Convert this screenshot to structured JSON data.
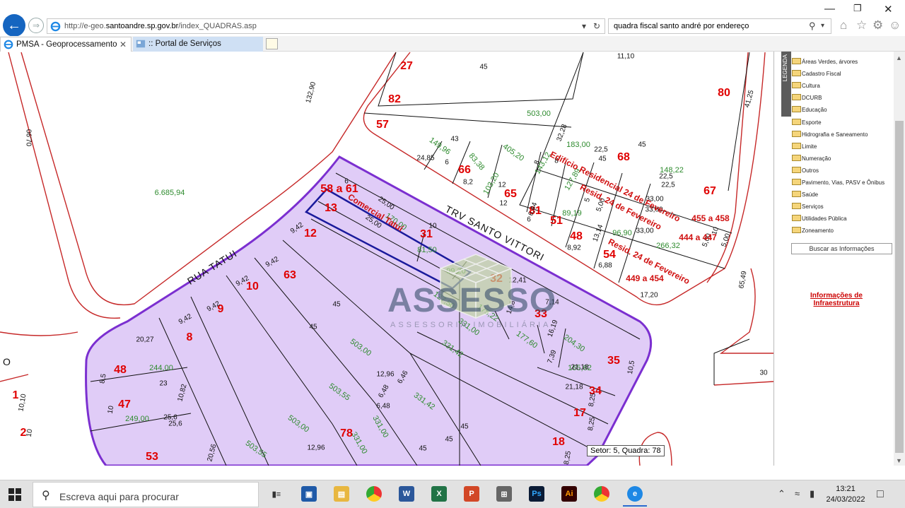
{
  "browser": {
    "url_prefix": "http://e-geo.",
    "url_domain": "santoandre.sp.gov.br",
    "url_path": "/index_QUADRAS.asp",
    "search_query": "quadra fiscal santo andré por endereço",
    "tabs": [
      {
        "label": "PMSA - Geoprocessamento"
      },
      {
        "label": ":: Portal de Serviços"
      }
    ]
  },
  "map": {
    "street_labels": [
      "RUA TATUI",
      "TRV SANTO VITTORI"
    ],
    "lot_numbers": [
      "27",
      "82",
      "57",
      "80",
      "66",
      "65",
      "81",
      "68",
      "67",
      "58 a 61",
      "13",
      "31",
      "12",
      "51",
      "48",
      "54",
      "63",
      "32",
      "10",
      "33",
      "9",
      "8",
      "35",
      "48",
      "47",
      "34",
      "17",
      "1",
      "2",
      "53",
      "78",
      "18"
    ],
    "area_values": [
      "6.685,94",
      "503,00",
      "183,00",
      "149,96",
      "405,20",
      "83,38",
      "103,20",
      "143,12",
      "127,89",
      "148,22",
      "170,00",
      "81,50",
      "99,20",
      "89,19",
      "96,90",
      "266,32",
      "127,50",
      "175,22",
      "177,60",
      "204,30",
      "165,62",
      "331,00",
      "503,00",
      "331,42",
      "331,42",
      "244,00",
      "249,00",
      "503,55",
      "503,00",
      "503,55",
      "331,00",
      "331,00"
    ],
    "dimension_values": [
      "45",
      "132,90",
      "06'70",
      "41,25",
      "45",
      "22,5",
      "45",
      "24,85",
      "43",
      "8,2",
      "12",
      "12",
      "6",
      "6",
      "8",
      "22,5",
      "22,5",
      "33,00",
      "33,00",
      "33,00",
      "25,00",
      "25,00",
      "10",
      "6",
      "9,42",
      "9,42",
      "9,42",
      "9,42",
      "9,42",
      "20,27",
      "12,41",
      "7,14",
      "14,8",
      "16,19",
      "21,18",
      "21,18",
      "8,92",
      "6,88",
      "13,14",
      "17,20",
      "10,5",
      "12,96",
      "12,96",
      "6,48",
      "6,46",
      "6,48",
      "45",
      "45",
      "45",
      "45",
      "45",
      "8,5",
      "23",
      "10",
      "10,82",
      "25,6",
      "25,6",
      "10,10",
      "10",
      "8,25",
      "8,25",
      "8,25",
      "20,56",
      "5",
      "65,49",
      "30",
      "7,39",
      "8",
      "11,10",
      "10",
      "6,44",
      "32,28",
      "5,00",
      "5,00",
      "5,00"
    ],
    "red_annotations": [
      "Edifício Residencial 24 de Fevereiro",
      "455 a 458",
      "Resid. 24 de Fevereiro",
      "444 a 447",
      "Resid. 24 de Fevereiro",
      "449 a 454",
      "Comercial Tatuí"
    ],
    "misc_labels": [
      "O"
    ],
    "tooltip": "Setor: 5, Quadra: 78",
    "watermark": {
      "title": "ASSESSO",
      "subtitle": "ASSESSORIA IMOBILIÁRIA"
    },
    "colors": {
      "block_fill": "#e0ccf7",
      "block_outline": "#7b2fd0",
      "selected_lot": "#1a1a9c",
      "curb": "#c62828",
      "lot_number": "#e00000",
      "area": "#2e8b2e"
    }
  },
  "legend": {
    "tab_label": "LEGENDA",
    "layers": [
      "Áreas Verdes, árvores",
      "Cadastro Fiscal",
      "Cultura",
      "DCURB",
      "Educação",
      "Esporte",
      "Hidrografia e Saneamento",
      "Limite",
      "Numeração",
      "Outros",
      "Pavimento, Vias, PASV e Ônibus",
      "Saúde",
      "Serviços",
      "Utilidades Pública",
      "Zoneamento"
    ],
    "search_button": "Buscar as Informações",
    "infra_link": "Informações de Infraestrutura"
  },
  "taskbar": {
    "search_placeholder": "Escreva aqui para procurar",
    "time": "13:21",
    "date": "24/03/2022",
    "apps": [
      "task-view",
      "store",
      "file-explorer",
      "chrome",
      "word",
      "excel",
      "powerpoint",
      "calculator",
      "photoshop",
      "illustrator",
      "chrome-profile",
      "internet-explorer"
    ]
  }
}
